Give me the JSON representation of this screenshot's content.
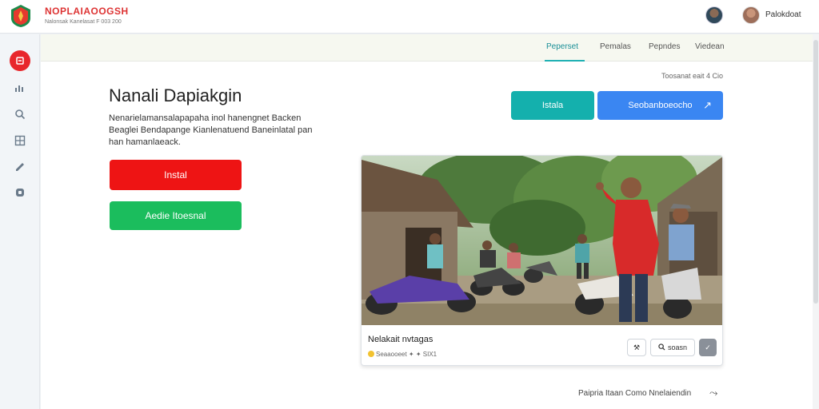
{
  "header": {
    "brand_title": "NOPLAIAOOGSH",
    "brand_sub": "Nalonsak Kanelasat F 003 200",
    "user_name": "Palokdoat"
  },
  "sidebar": {
    "items": [
      {
        "icon": "home-icon",
        "active": true
      },
      {
        "icon": "chart-icon",
        "active": false
      },
      {
        "icon": "search-icon",
        "active": false
      },
      {
        "icon": "grid-icon",
        "active": false
      },
      {
        "icon": "pen-icon",
        "active": false
      },
      {
        "icon": "settings-icon",
        "active": false
      }
    ]
  },
  "tabs": [
    {
      "label": "Peperset",
      "active": true
    },
    {
      "label": "Pemalas",
      "active": false
    },
    {
      "label": "Pepndes",
      "active": false
    },
    {
      "label": "Viedean",
      "active": false
    }
  ],
  "main": {
    "heading": "Nanali Dapiakgin",
    "description": "Nenarielamansalapapaha inol hanengnet Backen Beaglei Bendapange Kianlenatuend Baneinlatal pan han hamanlaeack.",
    "meta": "Toosanat eait 4 Cio",
    "install_label": "Instal",
    "secondary_label": "Aedie Itoesnal",
    "teal_label": "Istala",
    "blue_label": "Seobanboeocho"
  },
  "card": {
    "title": "Nelakait nvtagas",
    "meta": "Seaaooeet  ✦ ✦  SIX1",
    "search_label": "soasn"
  },
  "footer": {
    "text": "Paipria Itaan  Como Nnelaiendin"
  },
  "colors": {
    "accent_red": "#ee1414",
    "accent_green": "#1bbd5d",
    "accent_teal": "#14b0ad",
    "accent_blue": "#3a86f2"
  }
}
